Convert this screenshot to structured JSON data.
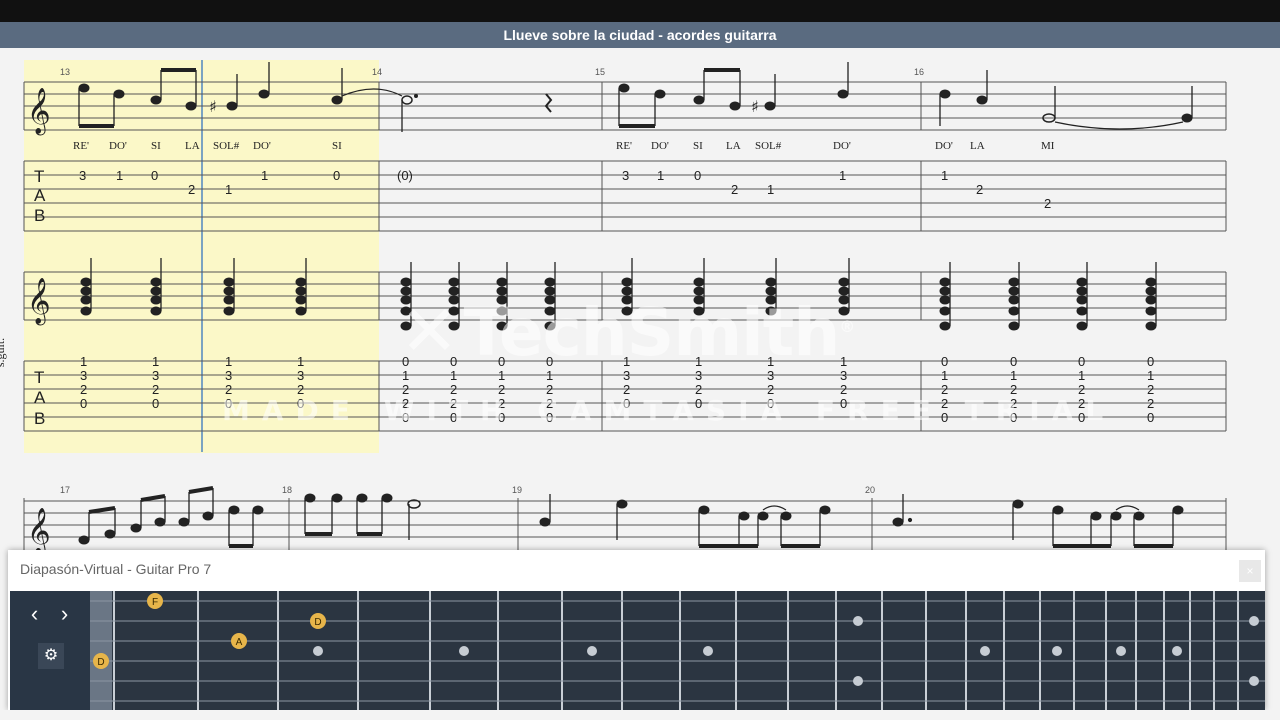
{
  "window": {
    "title": "Llueve sobre la ciudad - acordes guitarra"
  },
  "score": {
    "instrument_label": "s.guit.",
    "clef_symbol": "𝄞",
    "tab_letters": [
      "T",
      "A",
      "B"
    ],
    "measure_numbers": [
      "13",
      "14",
      "15",
      "16",
      "17",
      "18",
      "19",
      "20"
    ],
    "note_labels": [
      "RE'",
      "DO'",
      "SI",
      "LA",
      "SOL#",
      "DO'",
      "SI",
      "RE'",
      "DO'",
      "SI",
      "LA",
      "SOL#",
      "DO'",
      "DO'",
      "LA",
      "MI"
    ],
    "melody_tab": {
      "m13": [
        {
          "fret": "3",
          "string": 1
        },
        {
          "fret": "1",
          "string": 1
        },
        {
          "fret": "0",
          "string": 1
        },
        {
          "fret": "2",
          "string": 2
        },
        {
          "fret": "1",
          "string": 2
        },
        {
          "fret": "1",
          "string": 1
        },
        {
          "fret": "0",
          "string": 1
        }
      ],
      "m14": [
        {
          "fret": "(0)",
          "string": 1
        }
      ],
      "m15": [
        {
          "fret": "3",
          "string": 1
        },
        {
          "fret": "1",
          "string": 1
        },
        {
          "fret": "0",
          "string": 1
        },
        {
          "fret": "2",
          "string": 2
        },
        {
          "fret": "1",
          "string": 2
        },
        {
          "fret": "1",
          "string": 1
        }
      ],
      "m16": [
        {
          "fret": "1",
          "string": 1
        },
        {
          "fret": "2",
          "string": 2
        },
        {
          "fret": "2",
          "string": 3
        }
      ]
    },
    "chord_tab": {
      "m13": [
        "1",
        "3",
        "2",
        "0"
      ],
      "m14": [
        "0",
        "1",
        "2",
        "2",
        "0"
      ],
      "m15": [
        "1",
        "3",
        "2",
        "0"
      ],
      "m15_last": [
        "1",
        "3",
        "2",
        "0"
      ],
      "m16": [
        "0",
        "1",
        "2",
        "2",
        "0"
      ]
    }
  },
  "watermark": {
    "logo": "TechSmith",
    "registered": "®",
    "line2": "MADE WITH CAMTASIA FREE TRIAL"
  },
  "fretboard_panel": {
    "title": "Diapasón-Virtual - Guitar Pro 7",
    "close_glyph": "×",
    "prev_glyph": "‹",
    "next_glyph": "›",
    "settings_glyph": "⚙",
    "note_markers": [
      "F",
      "A",
      "D",
      "D"
    ],
    "accent_color": "#e7b54a"
  }
}
